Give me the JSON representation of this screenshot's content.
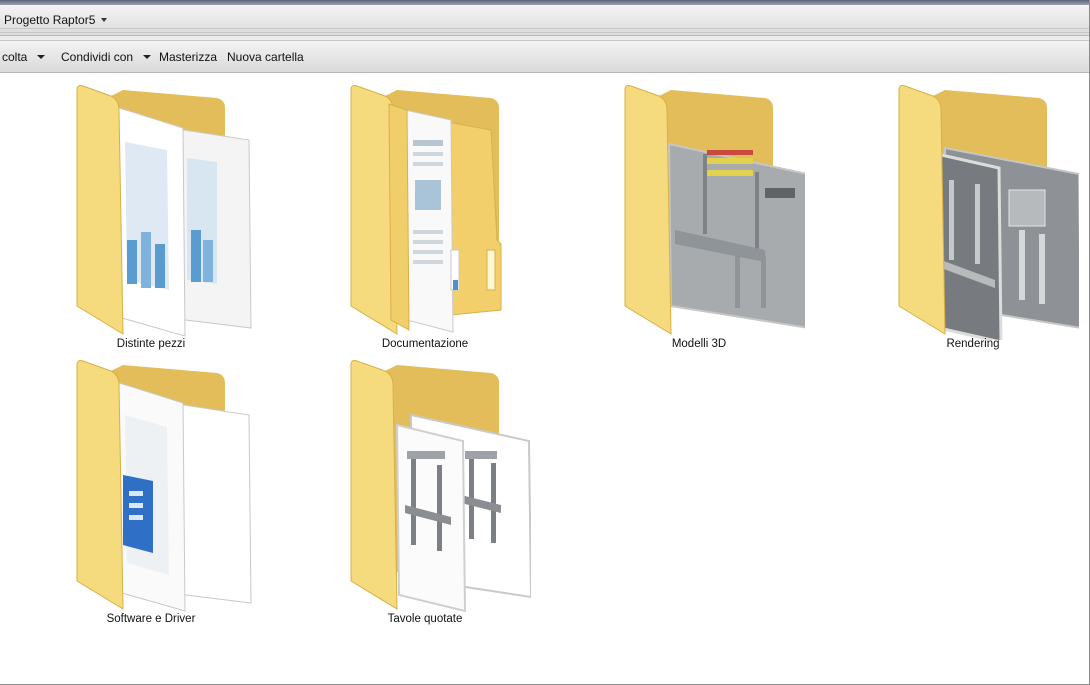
{
  "address_bar": {
    "path": "Progetto Raptor5"
  },
  "toolbar": {
    "items": [
      {
        "label": "colta",
        "has_dropdown": true
      },
      {
        "label": "Condividi con",
        "has_dropdown": true
      },
      {
        "label": "Masterizza",
        "has_dropdown": false
      },
      {
        "label": "Nuova cartella",
        "has_dropdown": false
      }
    ]
  },
  "folders": [
    {
      "name": "Distinte pezzi",
      "preview": "documents-chart"
    },
    {
      "name": "Documentazione",
      "preview": "manual-pages"
    },
    {
      "name": "Modelli 3D",
      "preview": "3d-machine"
    },
    {
      "name": "Rendering",
      "preview": "render-images"
    },
    {
      "name": "Software e Driver",
      "preview": "word-document"
    },
    {
      "name": "Tavole quotate",
      "preview": "drawings"
    }
  ],
  "colors": {
    "folder_yellow": "#f3d67a",
    "folder_dark": "#d9b24c",
    "toolbar_bg": "#e4e4e4"
  }
}
